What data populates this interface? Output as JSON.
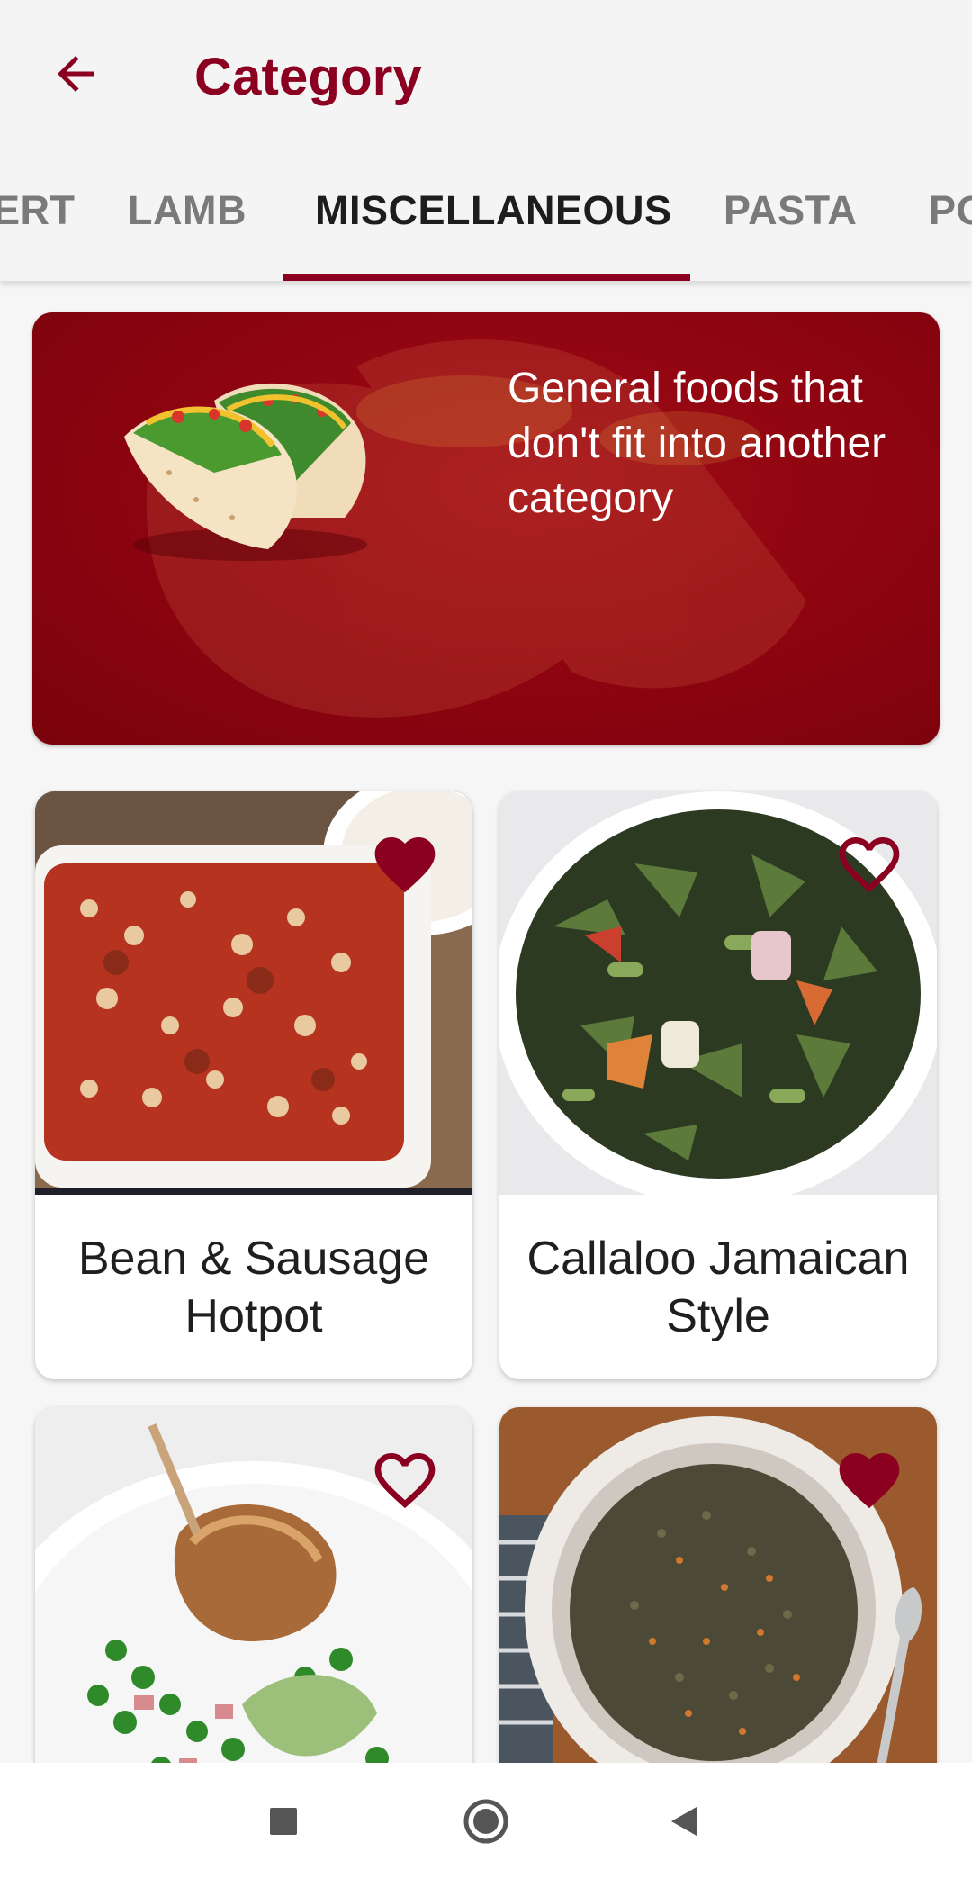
{
  "app_bar": {
    "title": "Category",
    "back_icon": "arrow-back-icon"
  },
  "tabs": [
    {
      "label": "ERT",
      "active": false
    },
    {
      "label": "LAMB",
      "active": false
    },
    {
      "label": "MISCELLANEOUS",
      "active": true
    },
    {
      "label": "PASTA",
      "active": false
    },
    {
      "label": "PO",
      "active": false
    }
  ],
  "banner": {
    "description": "General foods that don't fit into another category",
    "image_icon": "taco-image"
  },
  "recipes": [
    {
      "title": "Bean & Sausage Hotpot",
      "favorited": true
    },
    {
      "title": "Callaloo Jamaican Style",
      "favorited": false
    },
    {
      "title": "",
      "favorited": false
    },
    {
      "title": "",
      "favorited": true
    }
  ],
  "colors": {
    "accent": "#8b0020",
    "banner": "#8c0410",
    "heart": "#8b0020"
  },
  "nav": {
    "recents_icon": "square-icon",
    "home_icon": "circle-icon",
    "back_icon": "triangle-back-icon"
  }
}
